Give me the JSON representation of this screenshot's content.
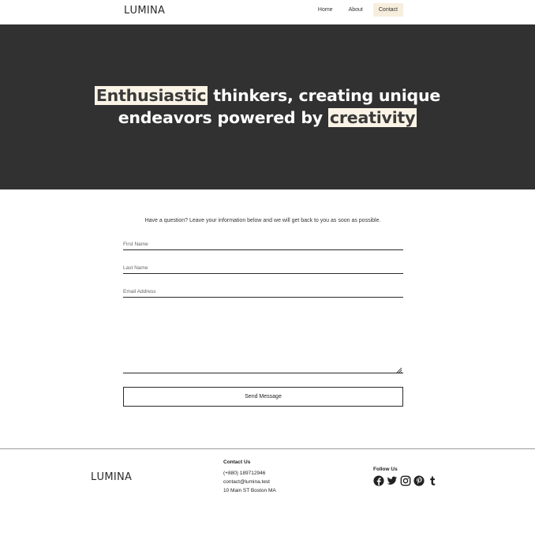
{
  "header": {
    "logo": {
      "mark": "L",
      "rest": "UMINA"
    },
    "nav": [
      {
        "label": "Home"
      },
      {
        "label": "About"
      },
      {
        "label": "Contact"
      }
    ]
  },
  "hero": {
    "line1": {
      "highlight": "Enthusiastic",
      "rest": " thinkers, creating unique"
    },
    "line2": {
      "lead": "endeavors powered by ",
      "highlight": "creativity"
    },
    "highlight_color": "#fbf4e6",
    "background": "#313131"
  },
  "form": {
    "intro": "Have a question? Leave your information below and we will get back to you as soon as possible.",
    "first_name_placeholder": "First Name",
    "last_name_placeholder": "Last Name",
    "email_placeholder": "Email Address",
    "message_placeholder": "",
    "submit_label": "Send Message"
  },
  "footer": {
    "logo": {
      "mark": "L",
      "rest": "UMINA"
    },
    "contact": {
      "heading": "Contact Us",
      "phone": "(+880) 189712946",
      "email": "contact@lumina.test",
      "address": "10 Main ST Boston MA"
    },
    "follow": {
      "heading": "Follow Us",
      "icons": [
        "facebook-icon",
        "twitter-icon",
        "instagram-icon",
        "pinterest-icon",
        "tumblr-icon"
      ]
    }
  },
  "colors": {
    "accent": "#f7eedd",
    "text": "#1f1f1f",
    "line": "#2a2a2a"
  }
}
